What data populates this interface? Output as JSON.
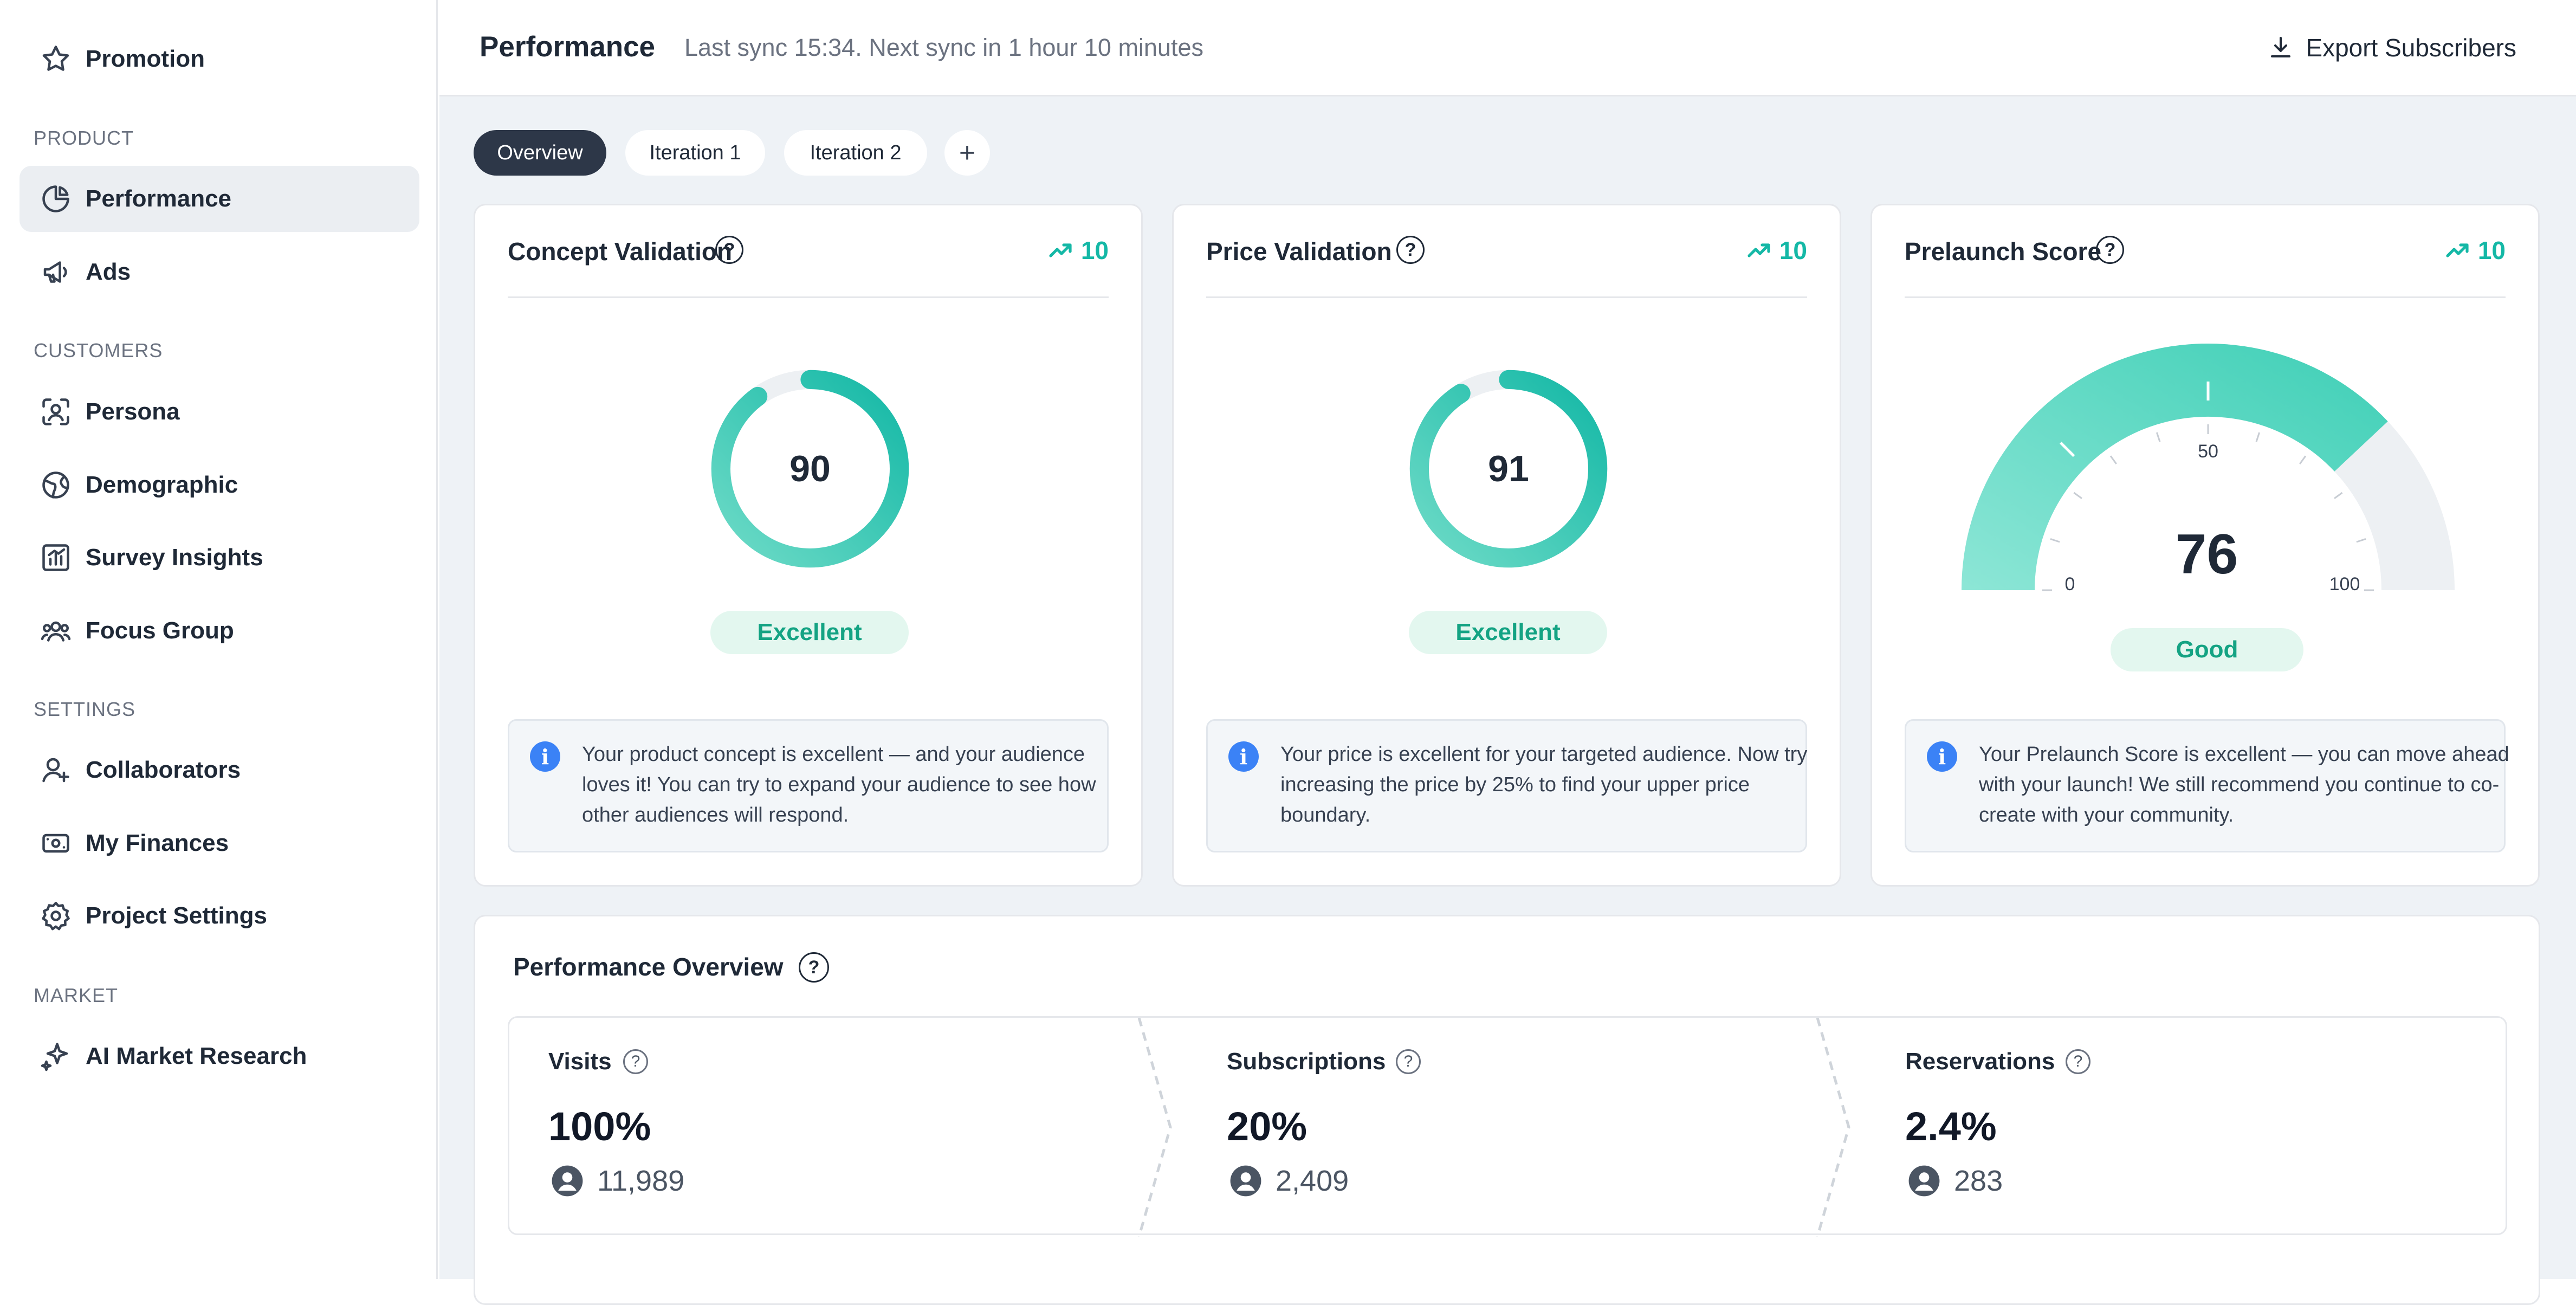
{
  "sidebar": {
    "top_item": {
      "label": "Promotion",
      "icon": "star-icon"
    },
    "sections": [
      {
        "label": "PRODUCT"
      },
      {
        "label": "CUSTOMERS"
      },
      {
        "label": "SETTINGS"
      },
      {
        "label": "MARKET"
      }
    ],
    "items": [
      {
        "label": "Performance",
        "icon": "pie-chart-icon",
        "active": true
      },
      {
        "label": "Ads",
        "icon": "megaphone-icon"
      },
      {
        "label": "Persona",
        "icon": "user-scan-icon"
      },
      {
        "label": "Demographic",
        "icon": "globe-icon"
      },
      {
        "label": "Survey Insights",
        "icon": "bar-chart-icon"
      },
      {
        "label": "Focus Group",
        "icon": "users-icon"
      },
      {
        "label": "Collaborators",
        "icon": "user-plus-icon"
      },
      {
        "label": "My Finances",
        "icon": "money-icon"
      },
      {
        "label": "Project Settings",
        "icon": "gear-icon"
      },
      {
        "label": "AI Market Research",
        "icon": "sparkles-icon"
      }
    ]
  },
  "header": {
    "title": "Performance",
    "sync_text": "Last sync 15:34. Next sync in 1 hour 10 minutes",
    "export_label": "Export Subscribers"
  },
  "tabs": [
    {
      "label": "Overview",
      "active": true
    },
    {
      "label": "Iteration 1"
    },
    {
      "label": "Iteration 2"
    }
  ],
  "tab_add_label": "+",
  "cards": [
    {
      "title": "Concept Validation",
      "trend": "10",
      "score": "90",
      "score_fraction": 0.9,
      "rating": "Excellent",
      "info": "Your product concept is excellent — and your audience loves it! You can try to expand your audience to see how other audiences will respond."
    },
    {
      "title": "Price Validation",
      "trend": "10",
      "score": "91",
      "score_fraction": 0.91,
      "rating": "Excellent",
      "info": "Your price is excellent for your targeted audience. Now try increasing the price by 25% to find your upper price boundary."
    },
    {
      "title": "Prelaunch Score",
      "trend": "10",
      "score": "76",
      "score_fraction": 0.76,
      "rating": "Good",
      "gauge_min": "0",
      "gauge_mid": "50",
      "gauge_max": "100",
      "info": "Your Prelaunch Score is excellent — you can move ahead with your launch! We still recommend you continue to co-create with your community."
    }
  ],
  "performance_overview": {
    "title": "Performance Overview",
    "metrics": [
      {
        "label": "Visits",
        "value": "100%",
        "count": "11,989"
      },
      {
        "label": "Subscriptions",
        "value": "20%",
        "count": "2,409"
      },
      {
        "label": "Reservations",
        "value": "2.4%",
        "count": "283"
      }
    ]
  },
  "colors": {
    "accent": "#14b8a6",
    "badge_bg": "#e3f7ef",
    "badge_text": "#14a383",
    "info_icon": "#3b82f6",
    "active_tab": "#2d3748"
  },
  "help_glyph": "?",
  "info_glyph": "i"
}
